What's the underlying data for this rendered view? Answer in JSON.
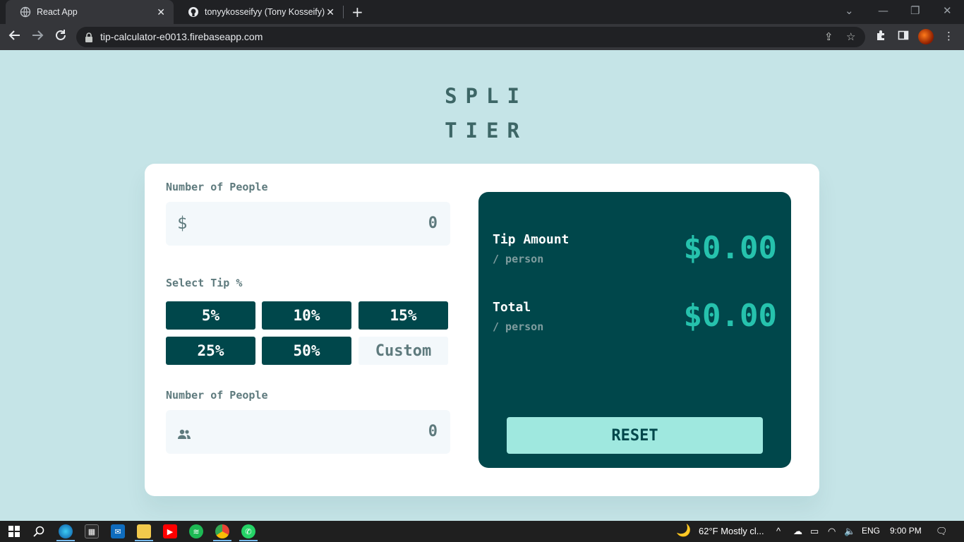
{
  "browser": {
    "tabs": [
      {
        "title": "React App",
        "active": true
      },
      {
        "title": "tonyykosseifyy (Tony Kosseify)",
        "active": false
      }
    ],
    "url": "tip-calculator-e0013.firebaseapp.com"
  },
  "app": {
    "logo_line1": "SPLI",
    "logo_line2": "TIER",
    "bill": {
      "label": "Number of People",
      "icon": "$",
      "value": "0"
    },
    "tip": {
      "label": "Select Tip %",
      "options": [
        "5%",
        "10%",
        "15%",
        "25%",
        "50%"
      ],
      "custom_placeholder": "Custom"
    },
    "people": {
      "label": "Number of People",
      "value": "0"
    },
    "results": {
      "tip_label": "Tip Amount",
      "tip_sub": "/ person",
      "tip_value": "$0.00",
      "total_label": "Total",
      "total_sub": "/ person",
      "total_value": "$0.00",
      "reset_label": "RESET"
    }
  },
  "taskbar": {
    "weather": "62°F  Mostly cl...",
    "lang": "ENG",
    "time": "9:00 PM"
  },
  "colors": {
    "background": "#c5e4e7",
    "dark_cyan": "#00474b",
    "strong_cyan": "#26c2ad",
    "reset_bg": "#9fe8df"
  }
}
